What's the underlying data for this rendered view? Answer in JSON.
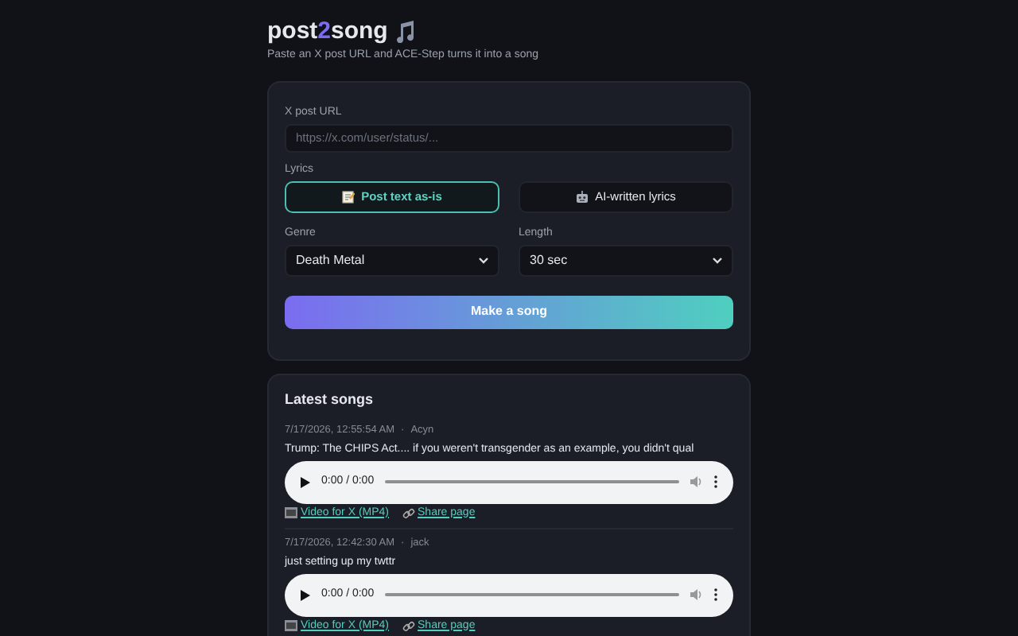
{
  "header": {
    "title_start": "post",
    "title_accent": "2",
    "title_end": "song",
    "subtitle": "Paste an X post URL and ACE-Step turns it into a song"
  },
  "form": {
    "url_label": "X post URL",
    "url_placeholder": "https://x.com/user/status/...",
    "lyrics_label": "Lyrics",
    "lyrics_modes": [
      {
        "label": "Post text as-is",
        "kind": "memo",
        "selected": true
      },
      {
        "label": "AI-written lyrics",
        "kind": "robot",
        "selected": false
      }
    ],
    "genre_label": "Genre",
    "genre_value": "Death Metal",
    "length_label": "Length",
    "length_value": "30 sec",
    "submit": "Make a song"
  },
  "latest": {
    "title": "Latest songs",
    "songs": [
      {
        "time": "7/17/2026, 12:55:54 AM",
        "separator": "·",
        "author": "Acyn",
        "text": "Trump: The CHIPS Act.... if you weren't transgender as an example, you didn't qual",
        "player_time": "0:00 / 0:00",
        "video_link": "Video for X (MP4)",
        "share_link": "Share page"
      },
      {
        "time": "7/17/2026, 12:42:30 AM",
        "separator": "·",
        "author": "jack",
        "text": "just setting up my twttr",
        "player_time": "0:00 / 0:00",
        "video_link": "Video for X (MP4)",
        "share_link": "Share page"
      }
    ]
  }
}
